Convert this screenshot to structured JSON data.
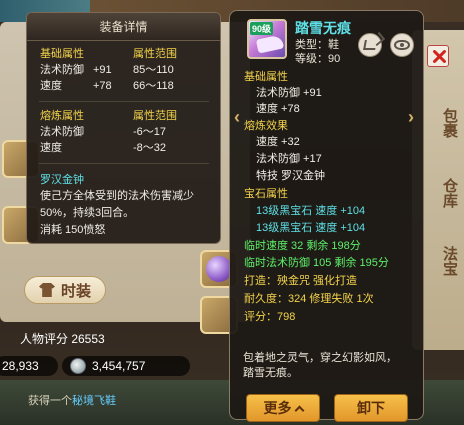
{
  "detail_panel": {
    "title": "装备详情",
    "basic_header": "基础属性",
    "basic_range_header": "属性范围",
    "basic_rows": [
      {
        "name": "法术防御",
        "value": "+91",
        "range": "85～110"
      },
      {
        "name": "速度",
        "value": "+78",
        "range": "66～118"
      }
    ],
    "refine_header": "熔炼属性",
    "refine_range_header": "属性范围",
    "refine_rows": [
      {
        "name": "法术防御",
        "range": "-6～17"
      },
      {
        "name": "速度",
        "range": "-8～32"
      }
    ],
    "skill_name": "罗汉金钟",
    "skill_desc_1": "使己方全体受到的法术伤害减少",
    "skill_desc_2": "50%，持续3回合。",
    "skill_cost": "消耗  150愤怒"
  },
  "item_panel": {
    "name": "踏雪无痕",
    "type_line": "类型：鞋",
    "level_line": "等级：90",
    "icon_level": "90级",
    "basic_header": "基础属性",
    "basic_rows": [
      "法术防御  +91",
      "速度  +78"
    ],
    "refine_header": "熔炼效果",
    "refine_rows": [
      "速度  +32",
      "法术防御  +17"
    ],
    "skill_line": "特技  罗汉金钟",
    "gem_header": "宝石属性",
    "gem_rows": [
      "13级黑宝石  速度  +104",
      "13级黑宝石  速度  +104"
    ],
    "temp_rows": [
      "临时速度  32  剩余  198分",
      "临时法术防御  105  剩余  195分"
    ],
    "forge_line": "打造：殃金咒   强化打造",
    "durability_line": "耐久度：324  修理失败  1次",
    "score_line": "评分：798",
    "description_1": "包着地之灵气，穿之幻影如风，",
    "description_2": "踏雪无痕。",
    "more_button": "更多",
    "unequip_button": "卸下",
    "left_arrow": "‹",
    "right_arrow": "›"
  },
  "background": {
    "fashion_button": "时装",
    "score_label": "人物评分  26553",
    "currency_1": "28,933",
    "currency_2": "3,454,757",
    "chat_prefix": "获得一个",
    "chat_highlight": "秘境飞鞋",
    "side_tab_1": "包裹",
    "side_tab_2": "仓库",
    "side_tab_3": "法宝"
  },
  "colors": {
    "name_cyan": "#5ee0e6",
    "header_yellow": "#f2d34b",
    "bonus_green": "#5ef06a",
    "button_gold": "#f6c04a"
  },
  "icons": [
    "share-icon",
    "eye-icon",
    "close-icon",
    "coin-icon",
    "shirt-icon",
    "chevron-up-icon"
  ]
}
